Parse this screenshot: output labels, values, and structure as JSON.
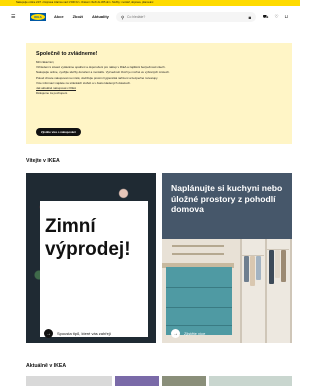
{
  "topbar": {
    "text": "Nakupujte online 24/7 • Doprava zdarma nad 1 500 Kč • Vrácení zboží do 365 dní • Služby: montáž, doprava, plánování"
  },
  "header": {
    "logo": "IKEA",
    "nav": [
      "Akce",
      "Zboží",
      "Aktuality"
    ],
    "search_placeholder": "Co hledáte?",
    "icons": [
      "menu-icon",
      "search-icon",
      "camera-icon",
      "truck-icon",
      "heart-icon",
      "cart-icon"
    ]
  },
  "notice": {
    "title": "Společně to zvládneme!",
    "p1": "Milí zákazníci,",
    "p2": "Vzhledem k situaci vydáváme opatření a doporučení pro nákup v IKEA a zajištění bezpečnosti všech.",
    "p3": "Nakupujte online, využijte služby doručení a montáže. Vyzvednutí zboží je možné ve vybraných místech.",
    "p4": "Pokud chcete nakupovat na místě, dodržujte prosím hygienická nařízení a bezpečné rozestupy.",
    "p5": "Více informací najdete na stránkách služeb a v často kladených dotazech.",
    "p6": "Děkujeme za pochopení.",
    "link1": "Jak aktuálně nakupovat v IKEA",
    "button": "Zjistěte více o nakupování"
  },
  "welcome": {
    "title": "Vítejte v IKEA"
  },
  "promo1": {
    "headline": "Zimní výprodej!",
    "link": "Spousta tipů, které vás zahřejí"
  },
  "promo2": {
    "headline": "Naplánujte si kuchyni nebo úložné prostory z pohodlí domova",
    "link": "Zjistěte více"
  },
  "news": {
    "title": "Aktuálně v IKEA"
  },
  "colors": {
    "yellow": "#ffdb00",
    "blue": "#0058a3",
    "notice_bg": "#fff5c6"
  }
}
